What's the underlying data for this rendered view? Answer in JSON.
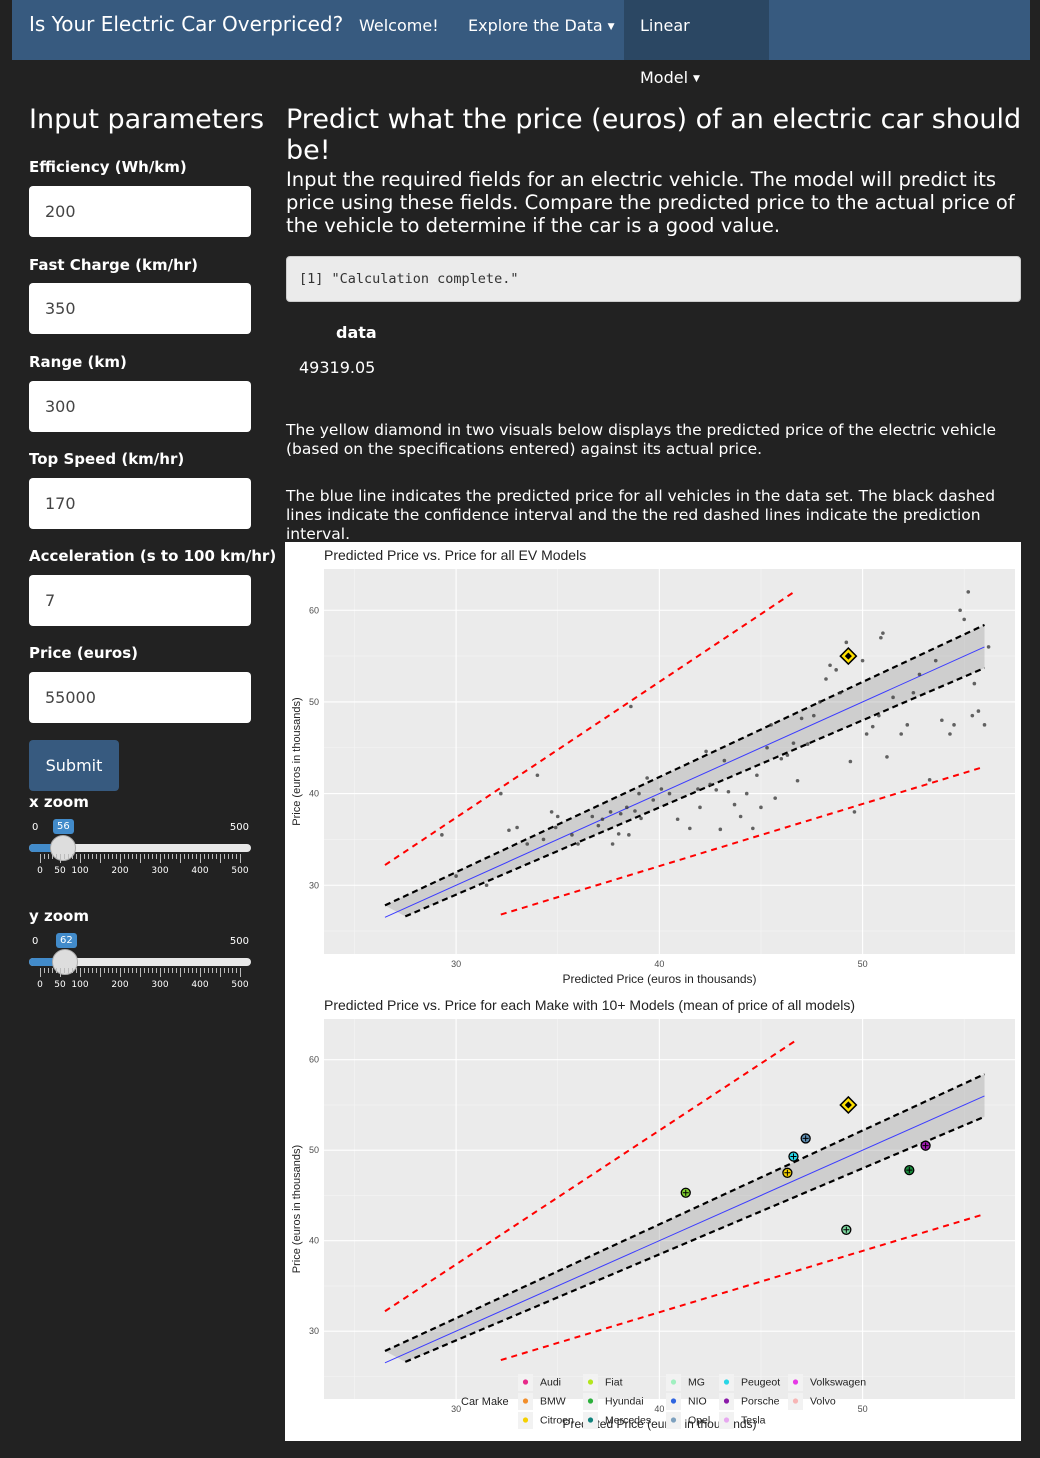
{
  "navbar": {
    "brand": "Is Your Electric Car Overpriced?",
    "items": [
      {
        "label": "Welcome!",
        "dropdown": false,
        "active": false
      },
      {
        "label": "Explore the Data",
        "dropdown": true,
        "active": false
      },
      {
        "label": "Linear Model",
        "dropdown": true,
        "active": true
      }
    ]
  },
  "sidebar": {
    "title": "Input parameters",
    "fields": [
      {
        "label": "Efficiency (Wh/km)",
        "value": "200"
      },
      {
        "label": "Fast Charge (km/hr)",
        "value": "350"
      },
      {
        "label": "Range (km)",
        "value": "300"
      },
      {
        "label": "Top Speed (km/hr)",
        "value": "170"
      },
      {
        "label": "Acceleration (s to 100 km/hr)",
        "value": "7"
      },
      {
        "label": "Price (euros)",
        "value": "55000"
      }
    ],
    "submit_label": "Submit",
    "x_zoom": {
      "label": "x zoom",
      "min": "0",
      "max": "500",
      "value": "56",
      "ticks": [
        "0",
        "50",
        "100",
        "200",
        "300",
        "400",
        "500"
      ]
    },
    "y_zoom": {
      "label": "y zoom",
      "min": "0",
      "max": "500",
      "value": "62",
      "ticks": [
        "0",
        "50",
        "100",
        "200",
        "300",
        "400",
        "500"
      ]
    }
  },
  "main": {
    "title": "Predict what the price (euros) of an electric car should be!",
    "intro": "Input the required fields for an electric vehicle. The model will predict its price using these fields. Compare the predicted price to the actual price of the vehicle to determine if the car is a good value.",
    "console_output": "[1] \"Calculation complete.\"",
    "table_header": "data",
    "table_value": "49319.05",
    "para1": "The yellow diamond in two visuals below displays the predicted price of the electric vehicle (based on the specifications entered) against its actual price.",
    "para2": "The blue line indicates the predicted price for all vehicles in the data set. The black dashed lines indicate the confidence interval and the the red dashed lines indicate the prediction interval."
  },
  "chart_data": [
    {
      "type": "scatter",
      "title": "Predicted Price vs. Price for all EV Models",
      "xlabel": "Predicted Price (euros in thousands)",
      "ylabel": "Price (euros in thousands)",
      "xlim": [
        23.5,
        57.5
      ],
      "ylim": [
        22.5,
        64.5
      ],
      "x_ticks": [
        30,
        40,
        50
      ],
      "y_ticks": [
        30,
        40,
        50,
        60
      ],
      "grid": true,
      "fit_line": {
        "x": [
          26.5,
          56
        ],
        "y": [
          26.5,
          56
        ]
      },
      "confidence_upper": {
        "x": [
          26.5,
          56
        ],
        "y": [
          27.8,
          58.4
        ]
      },
      "confidence_lower": {
        "x": [
          27.5,
          56
        ],
        "y": [
          26.6,
          53.7
        ]
      },
      "prediction_upper": {
        "x": [
          26.5,
          46.7
        ],
        "y": [
          32.2,
          62.1
        ]
      },
      "prediction_lower": {
        "x": [
          32.2,
          55.8
        ],
        "y": [
          26.8,
          42.8
        ]
      },
      "highlight": {
        "x": 49.3,
        "y": 55.0,
        "marker": "yellow diamond"
      },
      "points": [
        [
          29.3,
          35.5
        ],
        [
          30.0,
          31.0
        ],
        [
          31.5,
          30.0
        ],
        [
          32.2,
          40.0
        ],
        [
          32.6,
          36.0
        ],
        [
          33.0,
          36.3
        ],
        [
          34.0,
          42.0
        ],
        [
          33.5,
          34.5
        ],
        [
          34.3,
          35.0
        ],
        [
          34.9,
          36.3
        ],
        [
          34.7,
          38.0
        ],
        [
          35.0,
          37.5
        ],
        [
          35.7,
          35.5
        ],
        [
          36.0,
          34.5
        ],
        [
          36.7,
          37.5
        ],
        [
          37.0,
          36.5
        ],
        [
          37.2,
          37.2
        ],
        [
          37.6,
          38.0
        ],
        [
          37.7,
          34.5
        ],
        [
          38.0,
          35.6
        ],
        [
          38.1,
          37.8
        ],
        [
          38.4,
          38.5
        ],
        [
          38.5,
          35.5
        ],
        [
          38.8,
          38.1
        ],
        [
          39.0,
          40.0
        ],
        [
          39.1,
          37.3
        ],
        [
          39.4,
          41.7
        ],
        [
          39.7,
          39.3
        ],
        [
          40.1,
          40.5
        ],
        [
          40.5,
          40.0
        ],
        [
          40.9,
          37.2
        ],
        [
          41.5,
          36.2
        ],
        [
          41.9,
          40.5
        ],
        [
          42.0,
          38.5
        ],
        [
          42.3,
          44.6
        ],
        [
          42.5,
          41.0
        ],
        [
          42.8,
          40.4
        ],
        [
          43.0,
          36.1
        ],
        [
          43.2,
          43.6
        ],
        [
          43.4,
          40.2
        ],
        [
          43.7,
          38.8
        ],
        [
          44.0,
          37.5
        ],
        [
          44.3,
          40.0
        ],
        [
          44.6,
          36.2
        ],
        [
          44.8,
          42.0
        ],
        [
          45.0,
          38.5
        ],
        [
          45.3,
          45.0
        ],
        [
          45.5,
          47.5
        ],
        [
          45.7,
          39.5
        ],
        [
          46.0,
          43.8
        ],
        [
          46.3,
          44.2
        ],
        [
          46.6,
          45.5
        ],
        [
          46.8,
          41.4
        ],
        [
          47.0,
          48.2
        ],
        [
          47.3,
          45.4
        ],
        [
          47.6,
          48.5
        ],
        [
          47.9,
          50.0
        ],
        [
          48.2,
          52.5
        ],
        [
          48.4,
          54.0
        ],
        [
          48.7,
          53.5
        ],
        [
          48.9,
          51.0
        ],
        [
          49.2,
          56.5
        ],
        [
          49.4,
          43.5
        ],
        [
          49.6,
          38.0
        ],
        [
          50.0,
          54.5
        ],
        [
          50.2,
          46.5
        ],
        [
          50.5,
          47.3
        ],
        [
          50.8,
          48.5
        ],
        [
          51.0,
          57.5
        ],
        [
          51.2,
          44.0
        ],
        [
          51.5,
          50.5
        ],
        [
          51.9,
          46.5
        ],
        [
          52.2,
          47.5
        ],
        [
          52.5,
          51.0
        ],
        [
          52.8,
          53.0
        ],
        [
          53.3,
          41.5
        ],
        [
          53.6,
          54.5
        ],
        [
          53.9,
          48.0
        ],
        [
          54.3,
          46.5
        ],
        [
          54.5,
          47.5
        ],
        [
          54.8,
          60.0
        ],
        [
          55.0,
          59.0
        ],
        [
          55.2,
          62.0
        ],
        [
          55.4,
          48.5
        ],
        [
          55.7,
          49.0
        ],
        [
          56.0,
          47.5
        ],
        [
          56.2,
          56.0
        ],
        [
          55.5,
          52.0
        ],
        [
          50.9,
          57.0
        ],
        [
          38.6,
          49.5
        ]
      ]
    },
    {
      "type": "scatter",
      "title": "Predicted Price vs. Price for each Make with 10+ Models (mean of price of all models)",
      "xlabel": "Predicted Price (euros in thousands)",
      "ylabel": "Price (euros in thousands)",
      "xlim": [
        23.5,
        57.5
      ],
      "ylim": [
        22.5,
        64.5
      ],
      "x_ticks": [
        30,
        40,
        50
      ],
      "y_ticks": [
        30,
        40,
        50,
        60
      ],
      "grid": true,
      "highlight": {
        "x": 49.3,
        "y": 55.0,
        "marker": "yellow diamond"
      },
      "points": [
        {
          "x": 41.3,
          "y": 45.3,
          "color": "#7fd12e"
        },
        {
          "x": 46.3,
          "y": 47.5,
          "color": "#f5d000"
        },
        {
          "x": 46.6,
          "y": 49.3,
          "color": "#29d6e6"
        },
        {
          "x": 47.2,
          "y": 51.3,
          "color": "#5f8fb4"
        },
        {
          "x": 49.2,
          "y": 41.2,
          "color": "#7cd9a0"
        },
        {
          "x": 52.3,
          "y": 47.8,
          "color": "#1a8a3c"
        },
        {
          "x": 53.1,
          "y": 50.5,
          "color": "#a01ab0"
        }
      ],
      "legend": {
        "title": "Car Make",
        "placement": "bottom",
        "entries": [
          {
            "name": "Audi",
            "color": "#e7298a"
          },
          {
            "name": "BMW",
            "color": "#f28e2b"
          },
          {
            "name": "Citroen",
            "color": "#f5d000"
          },
          {
            "name": "Fiat",
            "color": "#b4e61d"
          },
          {
            "name": "Hyundai",
            "color": "#2cb03c"
          },
          {
            "name": "Mercedes",
            "color": "#11837d"
          },
          {
            "name": "MG",
            "color": "#a0f0c0"
          },
          {
            "name": "NIO",
            "color": "#2f65e0"
          },
          {
            "name": "Opel",
            "color": "#7ea1bf"
          },
          {
            "name": "Peugeot",
            "color": "#29d6e6"
          },
          {
            "name": "Porsche",
            "color": "#8a1aa8"
          },
          {
            "name": "Tesla",
            "color": "#e7a8f0"
          },
          {
            "name": "Volkswagen",
            "color": "#e639e6"
          },
          {
            "name": "Volvo",
            "color": "#f7b5b5"
          }
        ]
      }
    }
  ]
}
